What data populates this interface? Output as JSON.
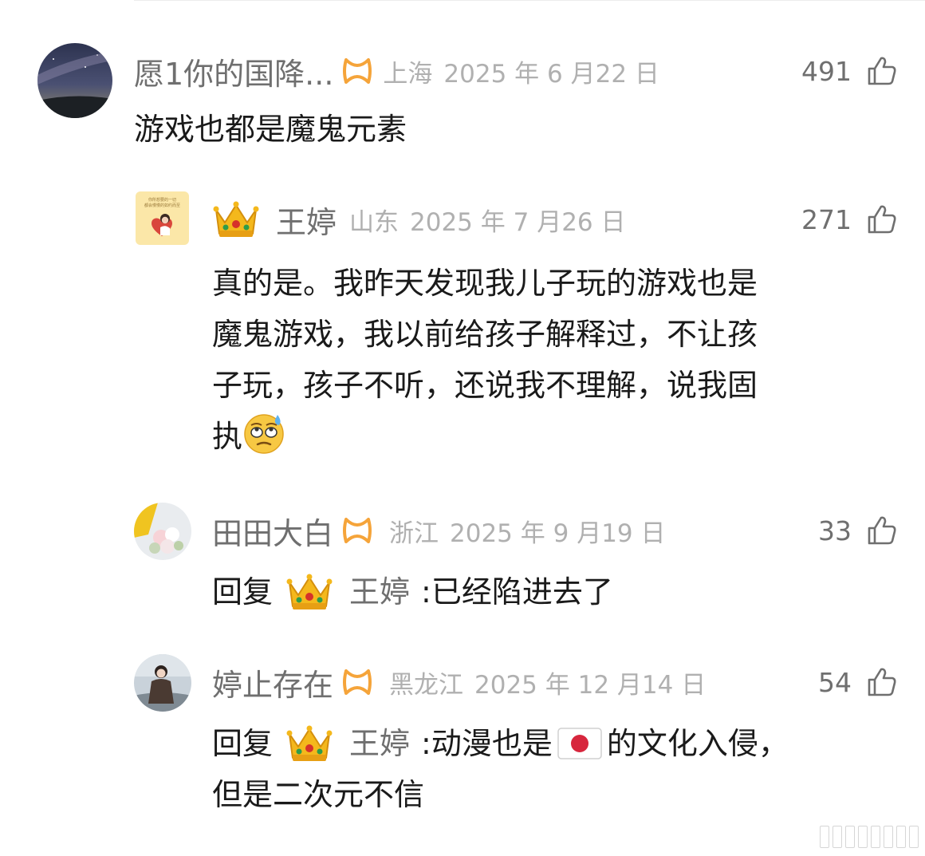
{
  "comments": [
    {
      "username": "愿1你的国降...",
      "location": "上海",
      "date": "2025 年 6 月22 日",
      "likes": "491",
      "text": "游戏也都是魔鬼元素"
    }
  ],
  "replies": [
    {
      "username": "王婷",
      "location": "山东",
      "date": "2025 年 7 月26 日",
      "likes": "271",
      "avatar_text": "你所想要的一切都会慢慢的如约而至",
      "lines": [
        "真的是。我昨天发现我儿子玩的游戏也是",
        "魔鬼游戏，我以前给孩子解释过，不让孩",
        "子玩，孩子不听，还说我不理解，说我固",
        "执"
      ],
      "emoji": "sweat-eye-roll-emoji"
    },
    {
      "username": "田田大白",
      "location": "浙江",
      "date": "2025 年 9 月19 日",
      "likes": "33",
      "reply_prefix": "回复",
      "reply_to": "王婷",
      "reply_text": ":已经陷进去了"
    },
    {
      "username": "婷止存在",
      "location": "黑龙江",
      "date": "2025 年 12 月14 日",
      "likes": "54",
      "reply_prefix": "回复",
      "reply_to": "王婷",
      "reply_text_before": ":动漫也是",
      "reply_text_after": "的文化入侵，",
      "reply_text_line2": "但是二次元不信",
      "flag": "japan-flag-emoji"
    }
  ],
  "colors": {
    "badge": "#f5a43a",
    "name": "#6f6f6f",
    "meta": "#b0b0b0",
    "text": "#1a1a1a"
  }
}
